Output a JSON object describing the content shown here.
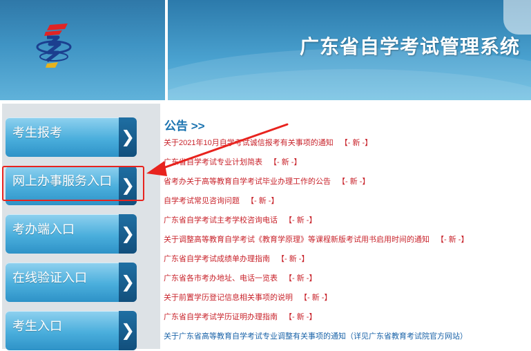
{
  "header": {
    "title": "广东省自学考试管理系统",
    "logo_icon": "exam-system-logo-icon"
  },
  "sidebar": {
    "items": [
      {
        "label": "考生报考",
        "icon": "chevron-right-icon"
      },
      {
        "label": "网上办事服务入口",
        "icon": "chevron-right-icon"
      },
      {
        "label": "考办端入口",
        "icon": "chevron-right-icon"
      },
      {
        "label": "在线验证入口",
        "icon": "chevron-right-icon"
      },
      {
        "label": "考生入口",
        "icon": "chevron-right-icon"
      }
    ]
  },
  "notice": {
    "title": "公告 >>",
    "new_tag": "【- 新 -】",
    "items": [
      "关于2021年10月自学考试诚信报考有关事项的通知",
      "广东省自学考试专业计划简表",
      "省考办关于高等教育自学考试毕业办理工作的公告",
      "自学考试常见咨询问题",
      "广东省自学考试主考学校咨询电话",
      "关于调整高等教育自学考试《教育学原理》等课程新版考试用书启用时间的通知",
      "广东省自学考试成绩单办理指南",
      "广东省各市考办地址、电话一览表",
      "关于前置学历登记信息相关事项的说明",
      "广东省自学考试学历证明办理指南",
      "关于广东省高等教育自学考试专业调整有关事项的通知（详见广东省教育考试院官方网站）"
    ]
  },
  "colors": {
    "header_blue": "#3f94c4",
    "notice_red": "#c8232b",
    "notice_blue": "#1a63a8",
    "highlight_red": "#e8231e"
  }
}
